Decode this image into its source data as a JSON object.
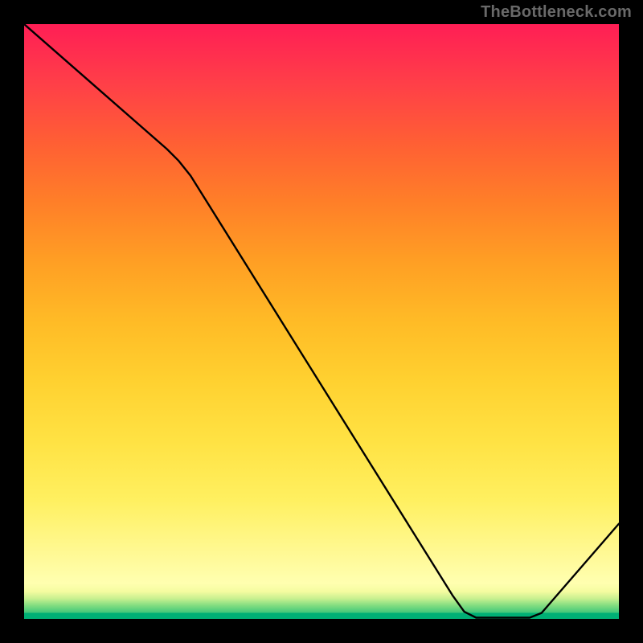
{
  "header": {
    "attribution": "TheBottleneck.com"
  },
  "chart_data": {
    "type": "line",
    "title": "",
    "xlabel": "",
    "ylabel": "",
    "xlim": [
      0,
      100
    ],
    "ylim": [
      0,
      100
    ],
    "baseline_label": "",
    "baseline_label_pos": {
      "x_pct": 75,
      "y_pct": 99
    },
    "curve_points": [
      {
        "x": 0,
        "y": 100
      },
      {
        "x": 24,
        "y": 79
      },
      {
        "x": 26,
        "y": 77
      },
      {
        "x": 28,
        "y": 74.5
      },
      {
        "x": 72,
        "y": 4
      },
      {
        "x": 74,
        "y": 1.2
      },
      {
        "x": 76,
        "y": 0.2
      },
      {
        "x": 85,
        "y": 0.2
      },
      {
        "x": 87,
        "y": 1.0
      },
      {
        "x": 100,
        "y": 16
      }
    ],
    "gradient_stops": [
      {
        "pct": 0,
        "color": "#00b075"
      },
      {
        "pct": 4,
        "color": "#c7f090"
      },
      {
        "pct": 8,
        "color": "#ffffb0"
      },
      {
        "pct": 25,
        "color": "#ffe243"
      },
      {
        "pct": 50,
        "color": "#ffbb26"
      },
      {
        "pct": 75,
        "color": "#ff6f30"
      },
      {
        "pct": 100,
        "color": "#ff1e55"
      }
    ]
  }
}
